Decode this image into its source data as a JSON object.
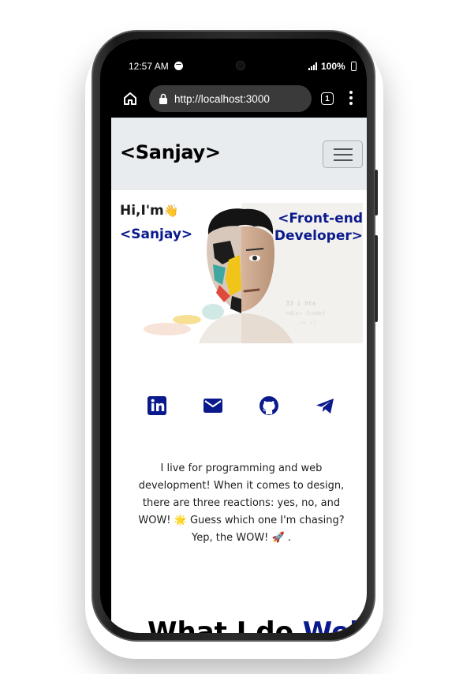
{
  "status_bar": {
    "time": "12:57 AM",
    "battery": "100%",
    "icons": [
      "spotify-icon",
      "camera",
      "signal-icon",
      "battery-icon"
    ]
  },
  "browser": {
    "url": "http://localhost:3000",
    "tab_count": "1",
    "icons": [
      "home-icon",
      "lock-icon",
      "tabs-icon",
      "more-vert-icon"
    ]
  },
  "navbar": {
    "brand": "<Sanjay>",
    "toggler_icon": "hamburger-icon"
  },
  "hero": {
    "greeting": "Hi,I'm",
    "greeting_emoji": "👋",
    "name": "<Sanjay>",
    "role": "<Front-end Developer>"
  },
  "social": [
    {
      "name": "linkedin-icon",
      "color": "#0a1a8c"
    },
    {
      "name": "mail-icon",
      "color": "#0a1a8c"
    },
    {
      "name": "github-icon",
      "color": "#0a1a8c"
    },
    {
      "name": "telegram-icon",
      "color": "#0a1a8c"
    }
  ],
  "about": {
    "text": "I live for programming and web development! When it comes to design, there are three reactions: yes, no, and WOW! 🌟 Guess which one I'm chasing? Yep, the WOW! 🚀 ."
  },
  "next_section": {
    "heading_start": "What I do",
    "heading_accent": " Web"
  },
  "colors": {
    "accent": "#0a1a8c",
    "navbar_bg": "#e8ecef",
    "page_bg": "#ffffff"
  }
}
